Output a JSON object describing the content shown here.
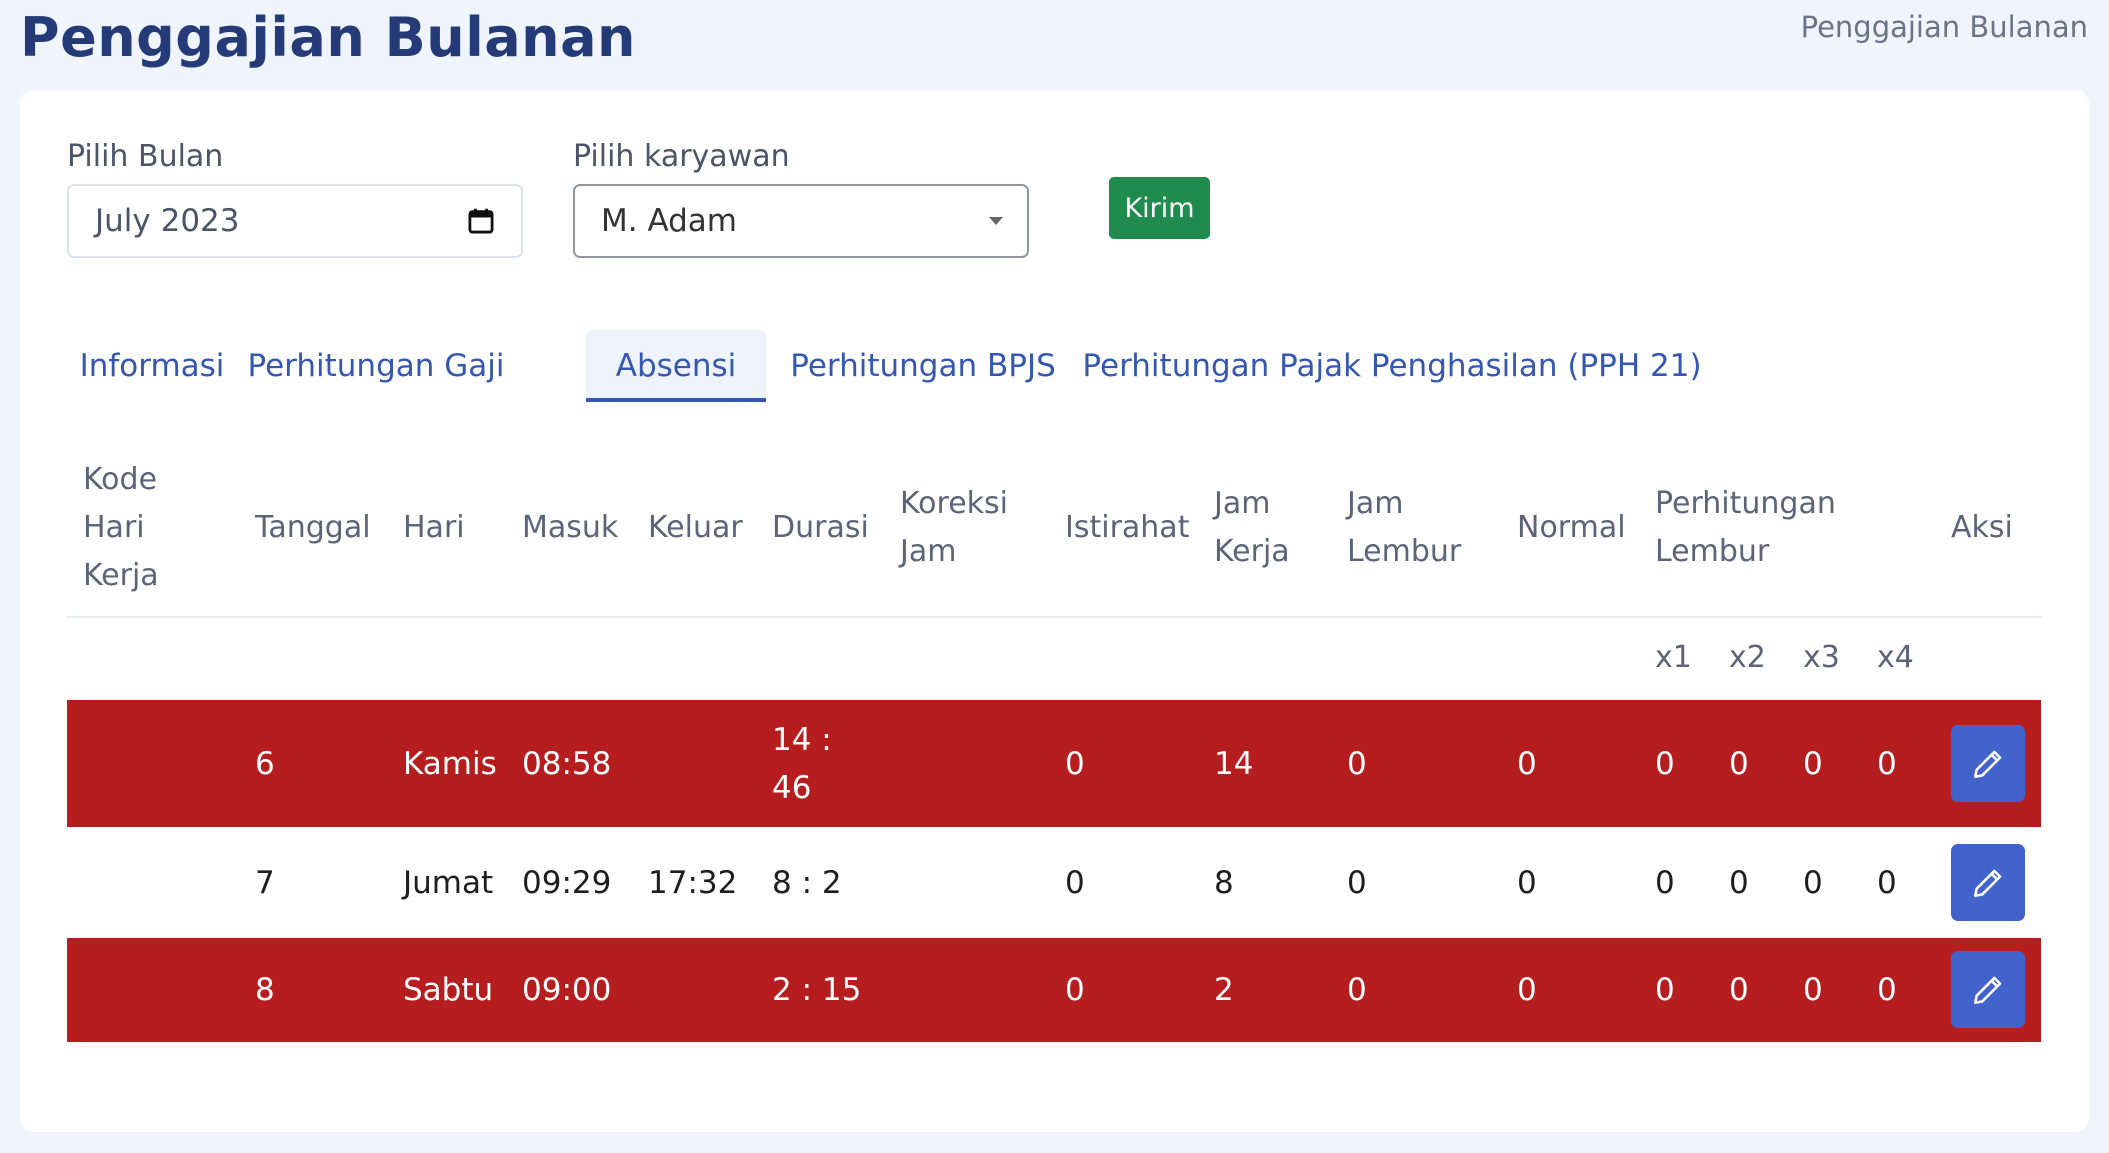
{
  "header": {
    "title": "Penggajian Bulanan",
    "breadcrumb": "Penggajian Bulanan"
  },
  "form": {
    "month_label": "Pilih Bulan",
    "month_value": "July 2023",
    "employee_label": "Pilih karyawan",
    "employee_value": "M. Adam",
    "submit_label": "Kirim"
  },
  "tabs": [
    {
      "label": "Informasi",
      "active": false
    },
    {
      "label": "Perhitungan Gaji",
      "active": false
    },
    {
      "label": "Absensi",
      "active": true
    },
    {
      "label": "Perhitungan BPJS",
      "active": false
    },
    {
      "label": "Perhitungan Pajak Penghasilan (PPH 21)",
      "active": false
    }
  ],
  "table": {
    "headers": {
      "kode": [
        "Kode",
        "Hari",
        "Kerja"
      ],
      "tanggal": "Tanggal",
      "hari": "Hari",
      "masuk": "Masuk",
      "keluar": "Keluar",
      "durasi": "Durasi",
      "koreksi": [
        "Koreksi",
        "Jam"
      ],
      "istirahat": "Istirahat",
      "jam_kerja": [
        "Jam",
        "Kerja"
      ],
      "jam_lembur": [
        "Jam",
        "Lembur"
      ],
      "normal": "Normal",
      "perhitungan_lembur": [
        "Perhitungan",
        "Lembur"
      ],
      "aksi": "Aksi",
      "multipliers": [
        "x1",
        "x2",
        "x3",
        "x4"
      ]
    },
    "rows": [
      {
        "kode": "",
        "tanggal": "6",
        "hari": "Kamis",
        "masuk": "08:58",
        "keluar": "",
        "durasi": [
          "14 :",
          "46"
        ],
        "koreksi": "",
        "istirahat": "0",
        "jam_kerja": "14",
        "jam_lembur": "0",
        "normal": "0",
        "x1": "0",
        "x2": "0",
        "x3": "0",
        "x4": "0",
        "highlight": "red"
      },
      {
        "kode": "",
        "tanggal": "7",
        "hari": "Jumat",
        "masuk": "09:29",
        "keluar": "17:32",
        "durasi": [
          "8 : 2"
        ],
        "koreksi": "",
        "istirahat": "0",
        "jam_kerja": "8",
        "jam_lembur": "0",
        "normal": "0",
        "x1": "0",
        "x2": "0",
        "x3": "0",
        "x4": "0",
        "highlight": "none"
      },
      {
        "kode": "",
        "tanggal": "8",
        "hari": "Sabtu",
        "masuk": "09:00",
        "keluar": "",
        "durasi": [
          "2 : 15"
        ],
        "koreksi": "",
        "istirahat": "0",
        "jam_kerja": "2",
        "jam_lembur": "0",
        "normal": "0",
        "x1": "0",
        "x2": "0",
        "x3": "0",
        "x4": "0",
        "highlight": "red"
      }
    ]
  },
  "icons": {
    "month_picker": "calendar-icon",
    "dropdown": "caret-down-icon",
    "row_action": "pencil-icon"
  },
  "colors": {
    "title": "#243b78",
    "tab_text": "#3557b0",
    "submit_button": "#1f8b4c",
    "highlight_row": "#b51d1e",
    "edit_button": "#4262cc"
  }
}
